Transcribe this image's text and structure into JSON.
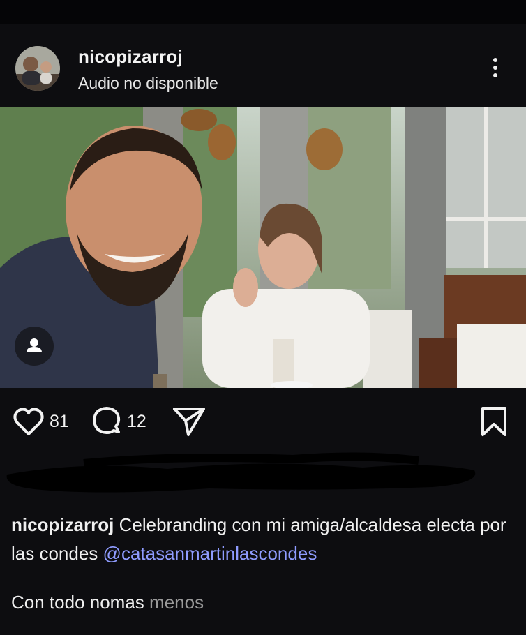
{
  "post": {
    "username": "nicopizarroj",
    "subtitle": "Audio no disponible"
  },
  "actions": {
    "likes": "81",
    "comments": "12"
  },
  "caption": {
    "username": "nicopizarroj",
    "text": "Celebranding con mi amiga/alcaldesa electa por las condes",
    "mention": "@catasanmartinlascondes",
    "second_line": "Con todo nomas",
    "less_label": "menos"
  },
  "icons": {
    "more": "more-vertical-icon",
    "like": "heart-icon",
    "comment": "comment-bubble-icon",
    "share": "send-icon",
    "save": "bookmark-icon",
    "tag": "user-tag-icon"
  }
}
